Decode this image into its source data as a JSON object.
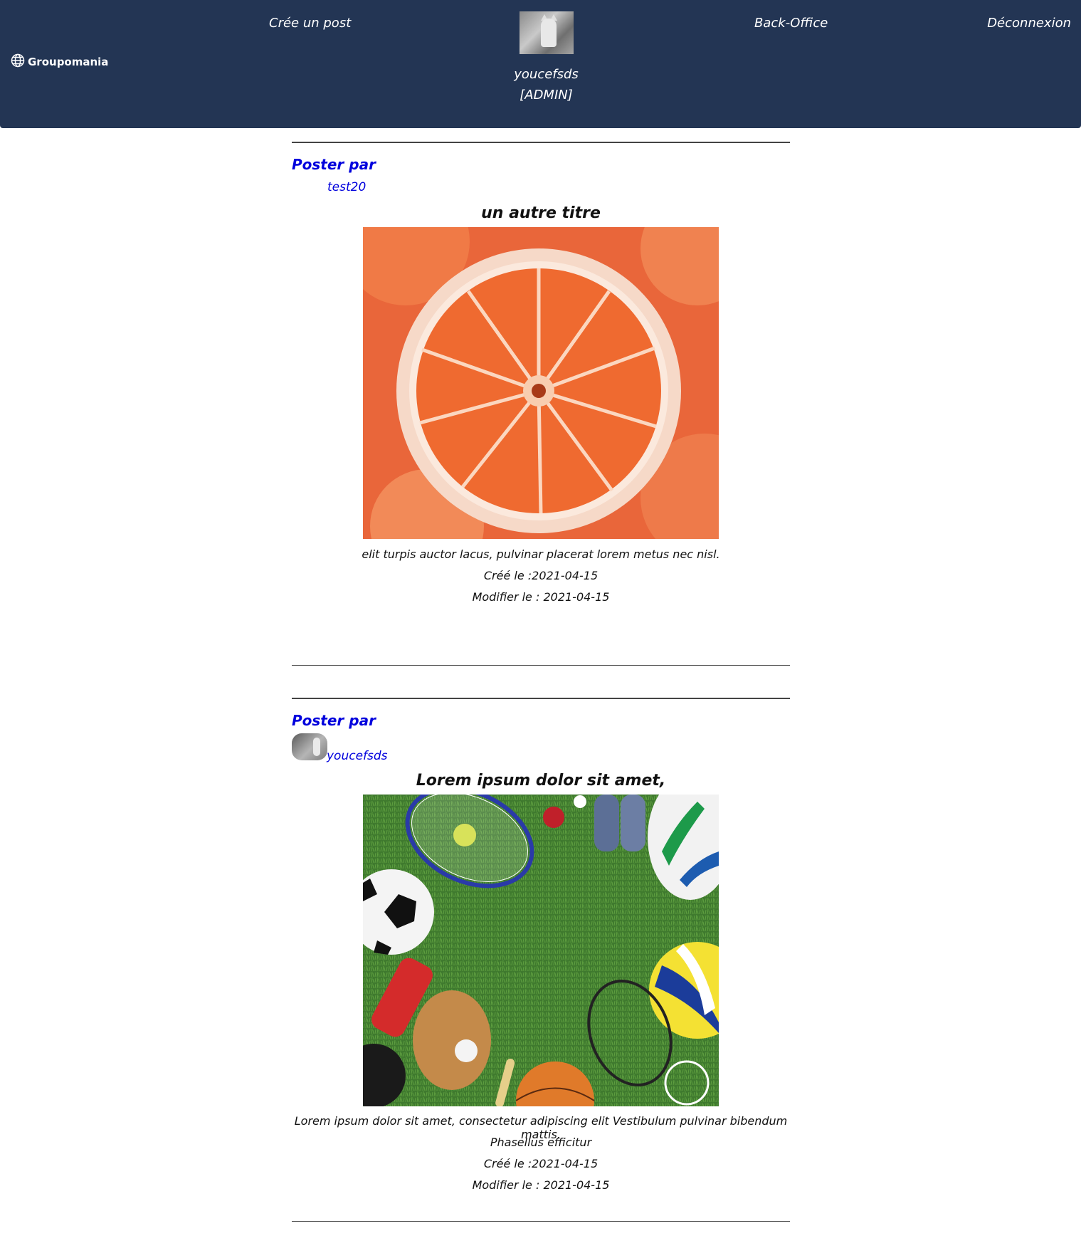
{
  "navbar": {
    "brand": "Groupomania",
    "links": {
      "create": "Crée un post",
      "backoffice": "Back-Office",
      "logout": "Déconnexion"
    },
    "user": {
      "name": "youcefsds",
      "role": "[ADMIN]"
    }
  },
  "posts": [
    {
      "poster_label": "Poster par",
      "author": "test20",
      "title": "un autre titre",
      "image": "orange-slice-image",
      "content": "elit turpis auctor lacus, pulvinar placerat lorem metus nec nisl.",
      "created": "Créé le :2021-04-15",
      "modified": "Modifier le : 2021-04-15"
    },
    {
      "poster_label": "Poster par",
      "author": "youcefsds",
      "title": "Lorem ipsum dolor sit amet,",
      "image": "sports-equipment-image",
      "content_line1": "Lorem ipsum dolor sit amet, consectetur adipiscing elit Vestibulum pulvinar bibendum mattis.",
      "content_line2": "Phasellus efficitur",
      "created": "Créé le :2021-04-15",
      "modified": "Modifier le : 2021-04-15"
    }
  ],
  "colors": {
    "navbar_bg": "#233554",
    "author_link": "#0000dd"
  }
}
